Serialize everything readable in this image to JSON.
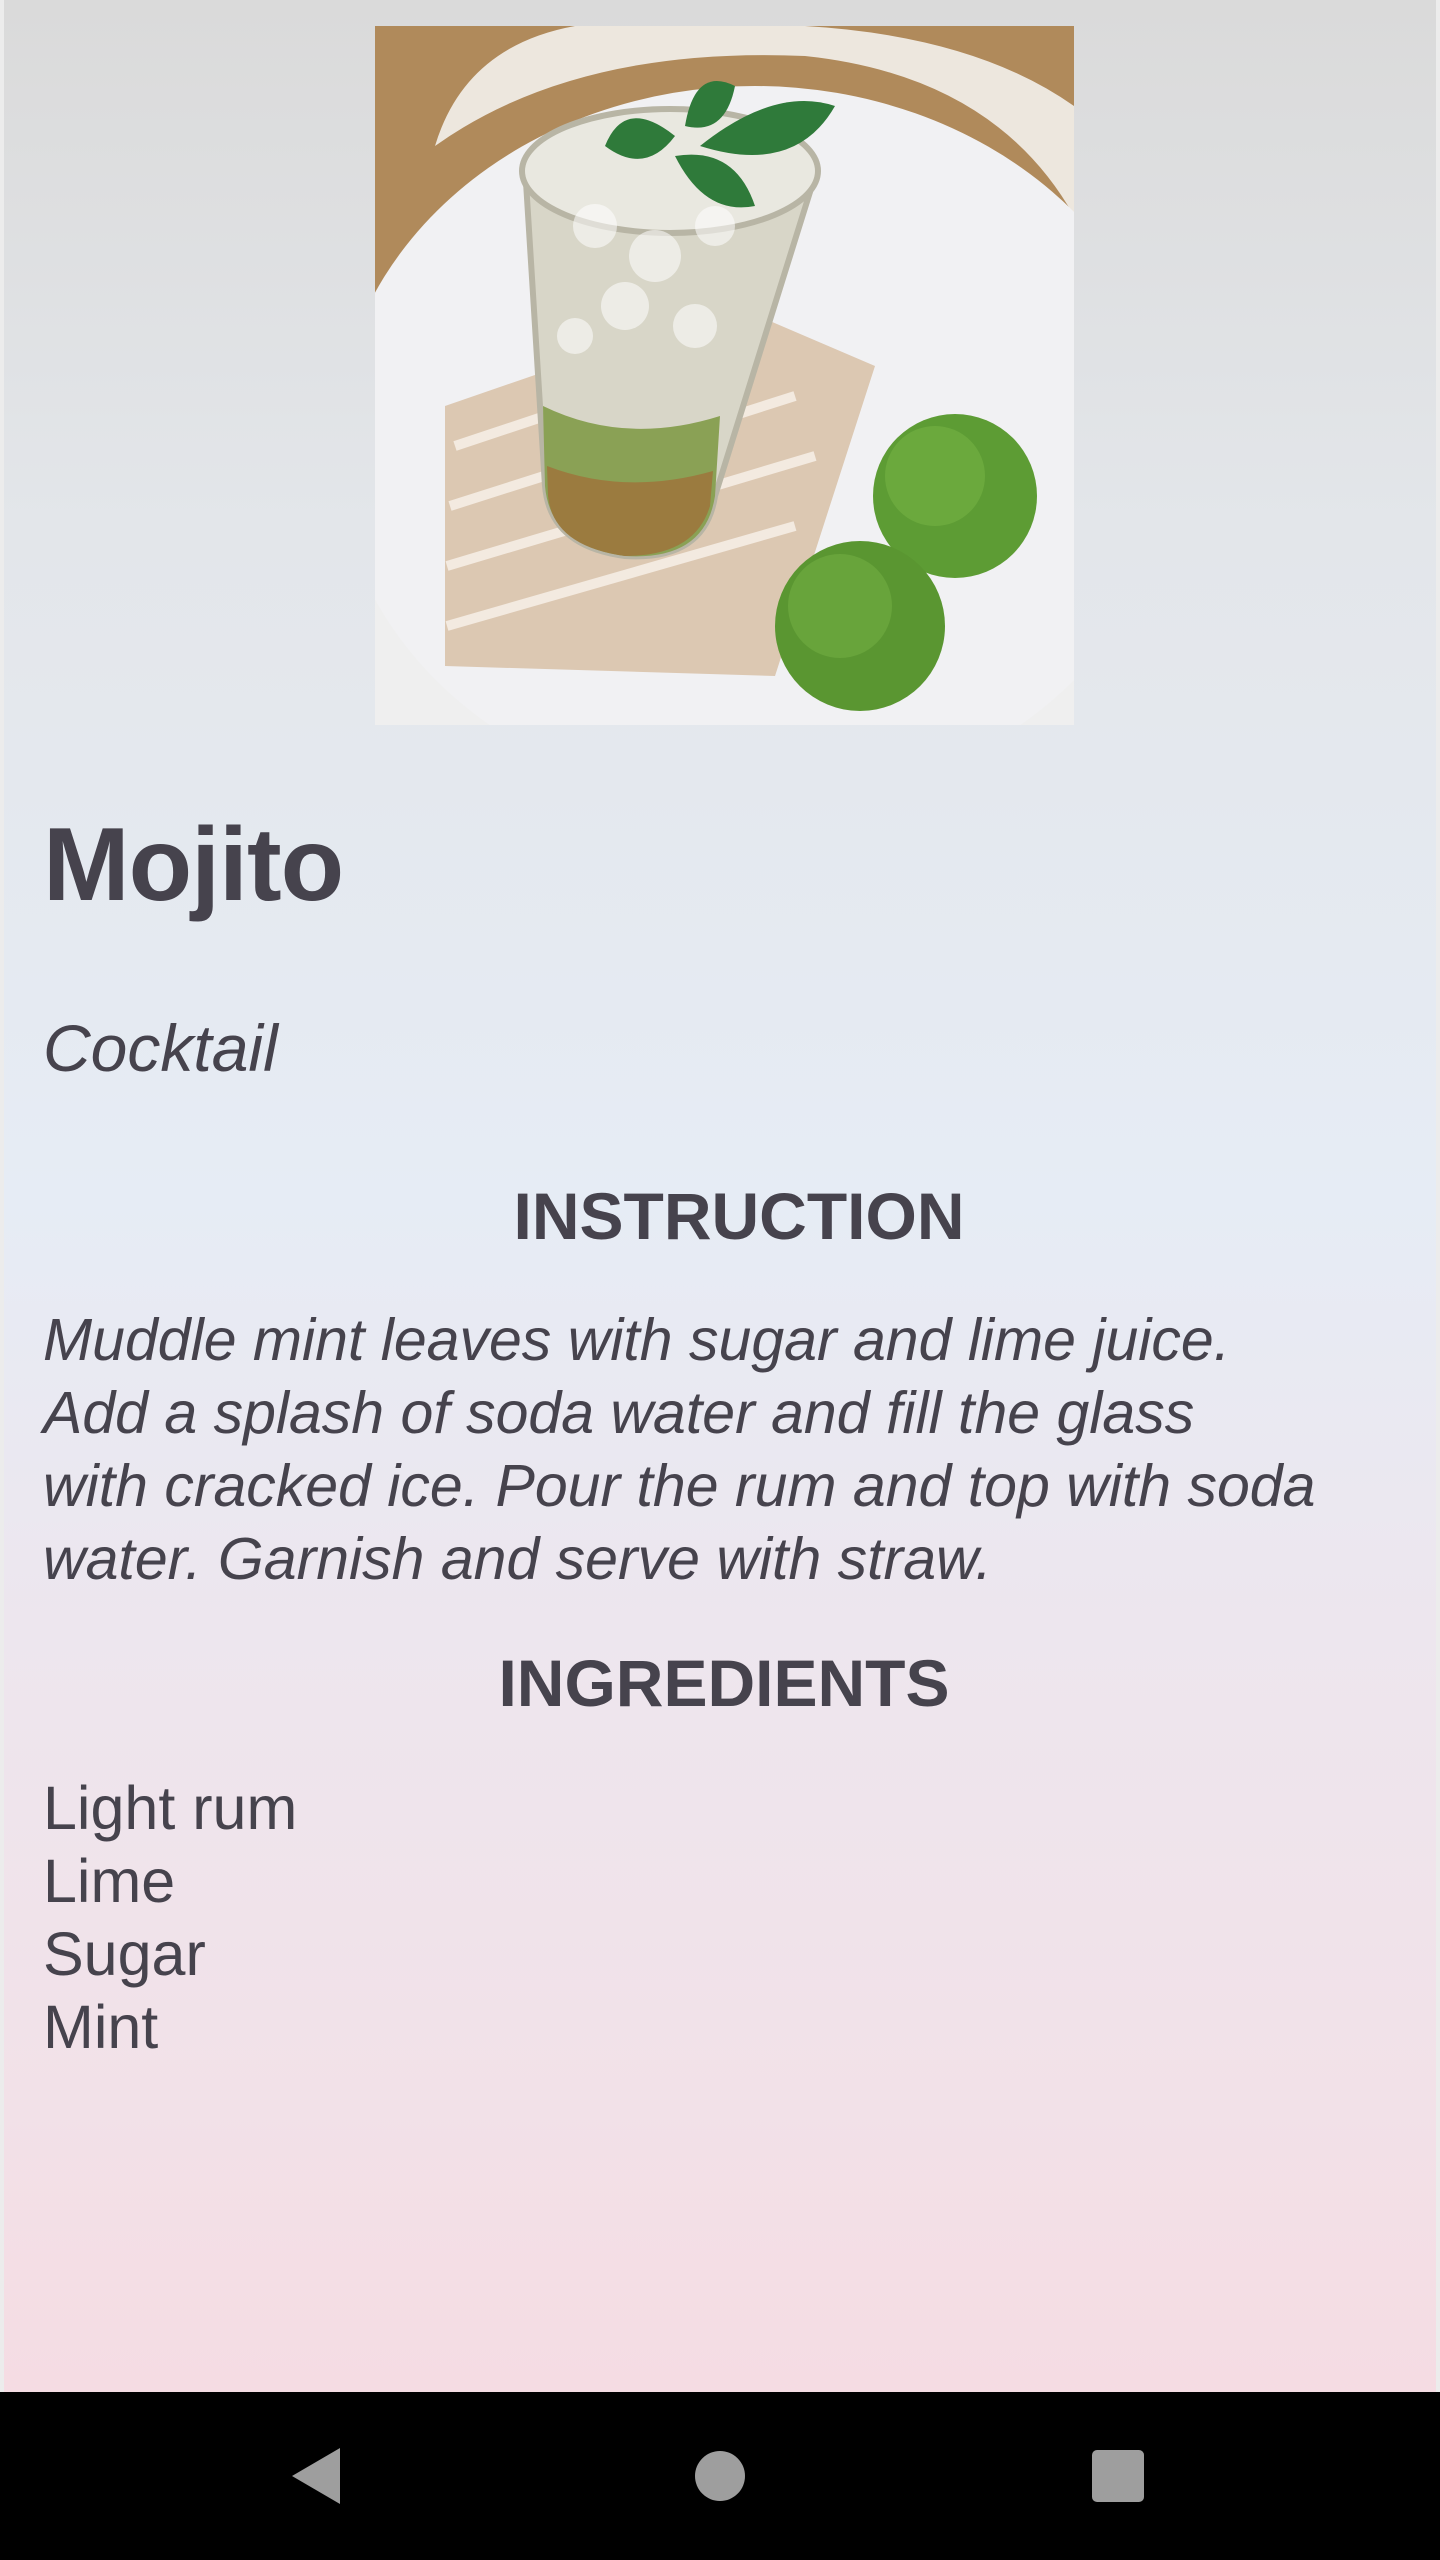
{
  "drink": {
    "name": "Mojito",
    "category": "Cocktail",
    "instruction_heading": "INSTRUCTION",
    "instructions_lines": [
      "Muddle mint leaves with sugar and lime juice.",
      "Add a splash of soda water and fill the glass",
      "with cracked ice. Pour the rum and top with soda",
      "water. Garnish and serve with straw."
    ],
    "ingredients_heading": "INGREDIENTS",
    "ingredients": [
      "Light rum",
      "Lime",
      "Sugar",
      "Mint"
    ]
  },
  "navigation": {
    "back_icon": "back-triangle-icon",
    "home_icon": "home-circle-icon",
    "recents_icon": "recents-square-icon"
  },
  "colors": {
    "text": "#46434d",
    "nav_background": "#000000",
    "nav_icon": "#9e9e9e"
  }
}
